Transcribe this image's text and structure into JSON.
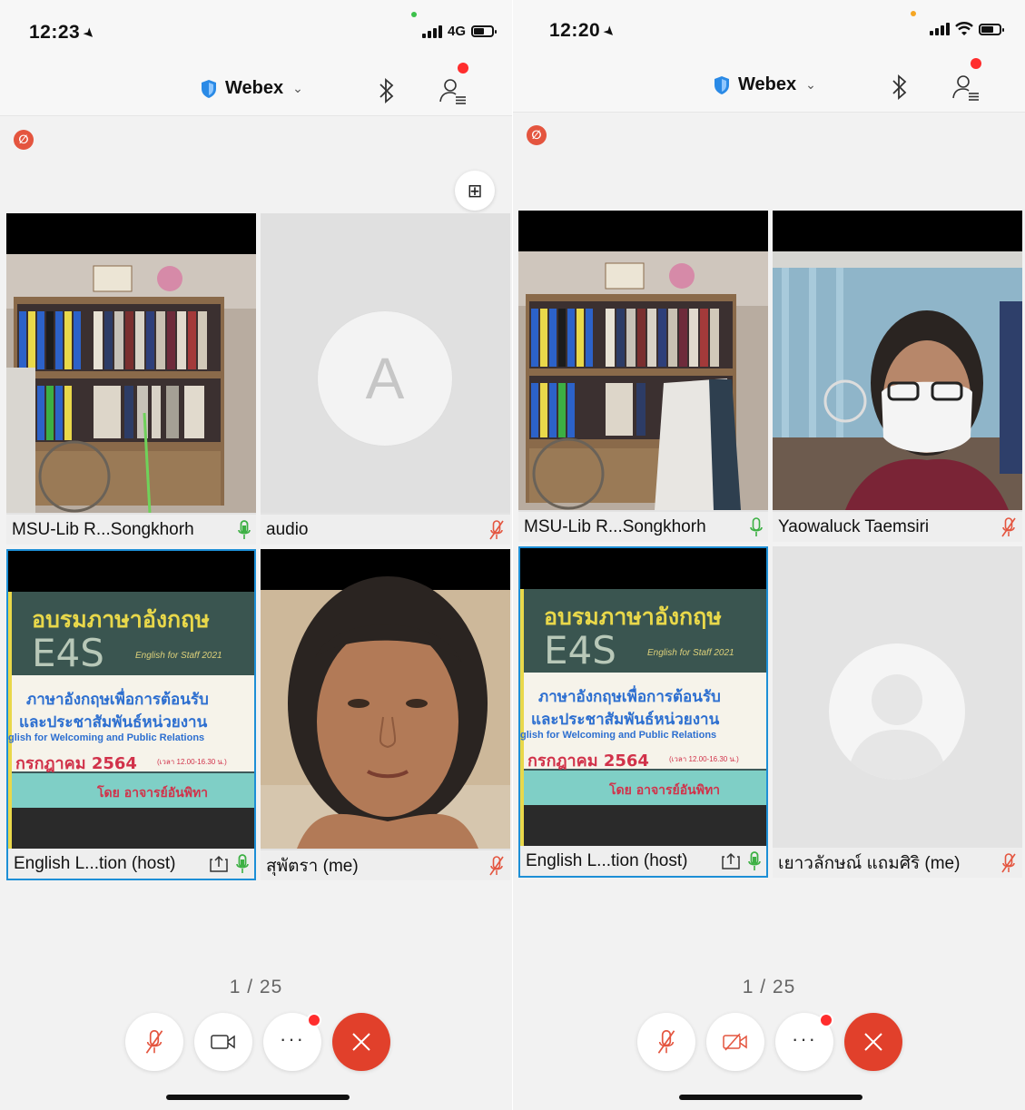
{
  "left": {
    "status": {
      "time": "12:23",
      "network": "4G"
    },
    "header": {
      "brand": "Webex"
    },
    "muted_badge": "∅",
    "tiles": [
      {
        "name": "MSU-Lib R...Songkhorh",
        "mic": "on"
      },
      {
        "name": "audio",
        "avatar_letter": "A",
        "mic": "off"
      },
      {
        "name": "English L...tion (host)",
        "mic": "on",
        "sharing": true
      },
      {
        "name": "สุพัตรา (me)",
        "mic": "off"
      }
    ],
    "pager": "1 / 25",
    "controls": {
      "video_state": "on"
    }
  },
  "right": {
    "status": {
      "time": "12:20"
    },
    "header": {
      "brand": "Webex"
    },
    "muted_badge": "∅",
    "tiles": [
      {
        "name": "MSU-Lib R...Songkhorh",
        "mic": "on"
      },
      {
        "name": "Yaowaluck Taemsiri",
        "mic": "off"
      },
      {
        "name": "English L...tion (host)",
        "mic": "on",
        "sharing": true
      },
      {
        "name": "เยาวลักษณ์ แถมศิริ (me)",
        "mic": "off"
      }
    ],
    "pager": "1 / 25",
    "controls": {
      "video_state": "off"
    }
  },
  "shared_slide": {
    "title_th": "อบรมภาษาอังกฤษ",
    "logo": "E4S",
    "year": "English for Staff 2021",
    "subtitle_th_1": "ภาษาอังกฤษเพื่อการต้อนรับ",
    "subtitle_th_2": "และประชาสัมพันธ์หน่วยงาน",
    "subtitle_en": "glish for Welcoming and Public Relations",
    "date": "กรกฎาคม 2564",
    "time": "(เวลา 12.00-16.30 น.)",
    "by": "โดย อาจารย์อันพิทา"
  },
  "colors": {
    "accent_blue": "#1d8fd6",
    "end_red": "#e1402b",
    "mute_red": "#e4553f",
    "mic_green": "#3cb043"
  }
}
